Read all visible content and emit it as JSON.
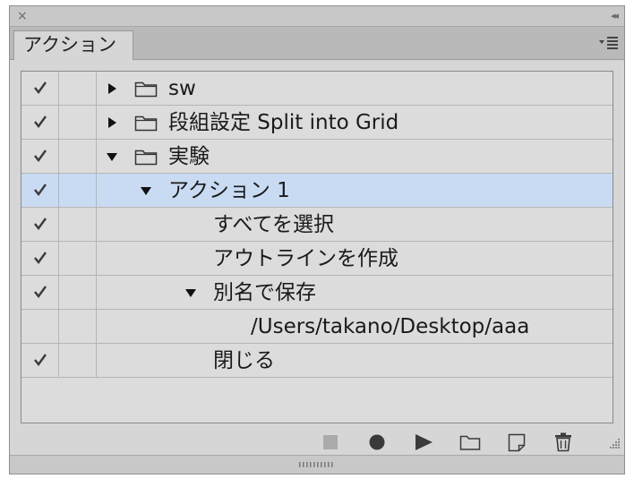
{
  "panel": {
    "close_glyph": "×",
    "collapse_glyph": "◂◂",
    "tab_label": "アクション"
  },
  "rows": [
    {
      "checked": true,
      "expand": "collapsed",
      "folder": true,
      "label": "sw"
    },
    {
      "checked": true,
      "expand": "collapsed",
      "folder": true,
      "label": "段組設定 Split into Grid"
    },
    {
      "checked": true,
      "expand": "expanded",
      "folder": true,
      "label": "実験"
    },
    {
      "checked": true,
      "expand": "expanded",
      "folder": false,
      "label": "アクション 1",
      "selected": true
    },
    {
      "checked": true,
      "expand": "none",
      "folder": false,
      "label": "すべてを選択"
    },
    {
      "checked": true,
      "expand": "none",
      "folder": false,
      "label": "アウトラインを作成"
    },
    {
      "checked": true,
      "expand": "expanded",
      "folder": false,
      "label": "別名で保存"
    },
    {
      "checked": false,
      "expand": "none",
      "folder": false,
      "label": "/Users/takano/Desktop/aaa"
    },
    {
      "checked": true,
      "expand": "none",
      "folder": false,
      "label": "閉じる"
    }
  ],
  "toolbar": {
    "icons": [
      "stop-icon",
      "record-icon",
      "play-icon",
      "new-set-folder-icon",
      "new-action-icon",
      "trash-icon"
    ]
  },
  "colors": {
    "selected_row": "#c9dbf3",
    "panel_bg": "#d6d6d6"
  }
}
